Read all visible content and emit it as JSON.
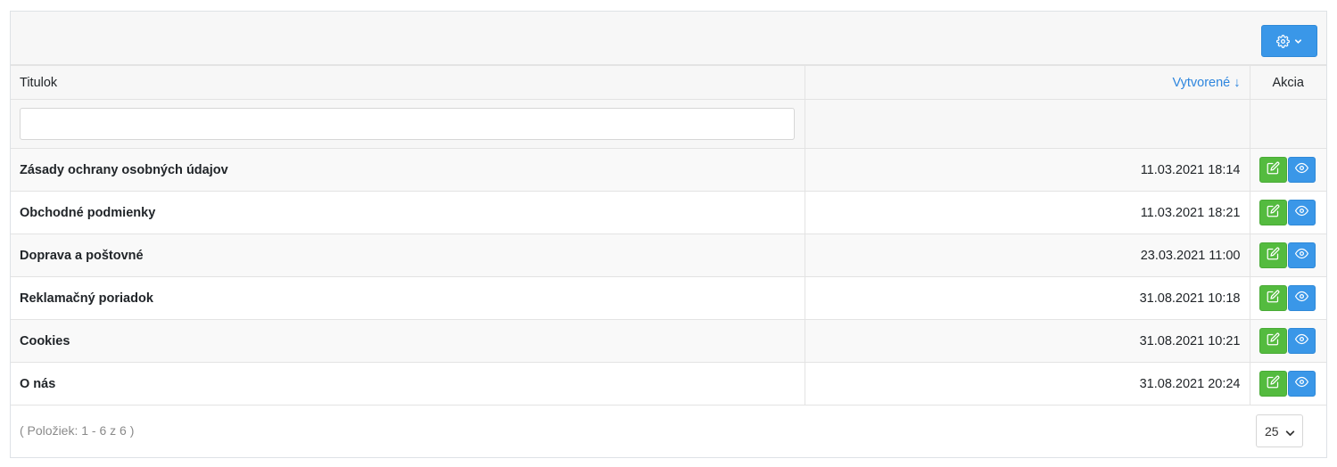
{
  "toolbar": {
    "settings_icon": "gear-icon",
    "dropdown_icon": "chevron-down-icon",
    "accent": "#3a97e8"
  },
  "columns": {
    "title": "Titulok",
    "created": "Vytvorené",
    "created_sort_indicator": "↓",
    "actions": "Akcia"
  },
  "filter": {
    "title_value": "",
    "title_placeholder": ""
  },
  "rows": [
    {
      "title": "Zásady ochrany osobných údajov",
      "created": "11.03.2021 18:14"
    },
    {
      "title": "Obchodné podmienky",
      "created": "11.03.2021 18:21"
    },
    {
      "title": "Doprava a poštovné",
      "created": "23.03.2021 11:00"
    },
    {
      "title": "Reklamačný poriadok",
      "created": "31.08.2021 10:18"
    },
    {
      "title": "Cookies",
      "created": "31.08.2021 10:21"
    },
    {
      "title": "O nás",
      "created": "31.08.2021 20:24"
    }
  ],
  "row_actions": {
    "edit_icon": "edit-icon",
    "view_icon": "eye-icon",
    "edit_color": "#54bb3f",
    "view_color": "#3a97e8"
  },
  "footer": {
    "pager_info": "( Položiek: 1 - 6 z 6 )",
    "page_size": "25"
  }
}
